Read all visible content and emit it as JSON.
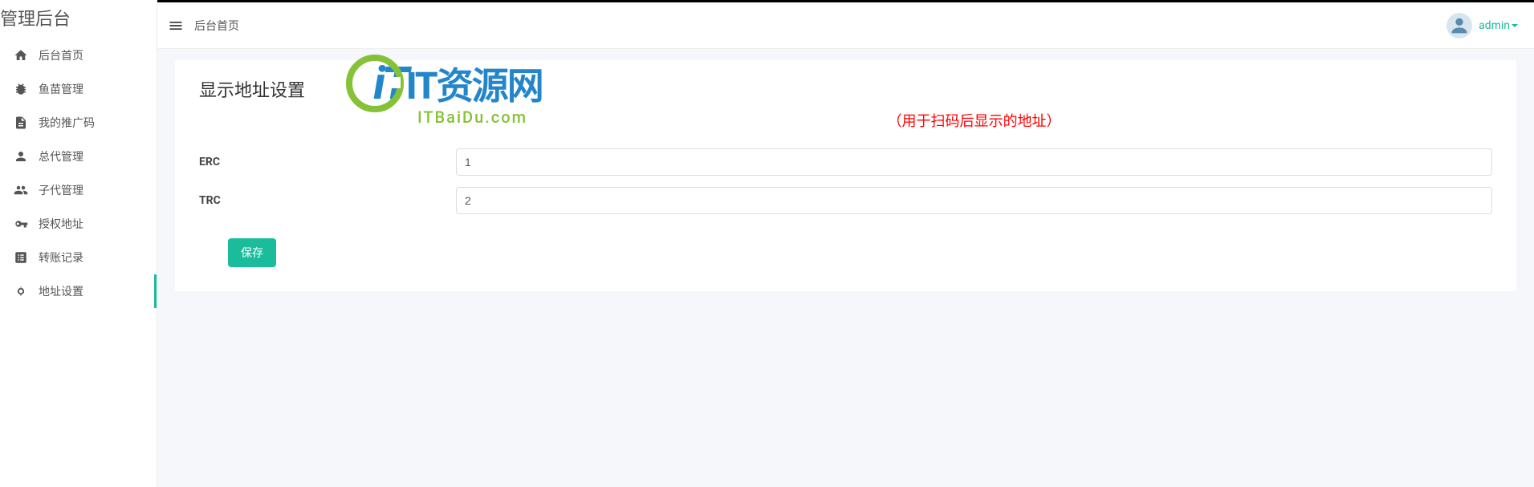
{
  "sidebar": {
    "title": "管理后台",
    "items": [
      {
        "label": "后台首页",
        "icon": "home"
      },
      {
        "label": "鱼苗管理",
        "icon": "bug"
      },
      {
        "label": "我的推广码",
        "icon": "file"
      },
      {
        "label": "总代管理",
        "icon": "person"
      },
      {
        "label": "子代管理",
        "icon": "group"
      },
      {
        "label": "授权地址",
        "icon": "key"
      },
      {
        "label": "转账记录",
        "icon": "list"
      },
      {
        "label": "地址设置",
        "icon": "settings-network"
      }
    ],
    "active_index": 7
  },
  "header": {
    "breadcrumb": "后台首页",
    "user_name": "admin"
  },
  "panel": {
    "title": "显示地址设置",
    "hint": "（用于扫码后显示的地址）",
    "fields": {
      "erc_label": "ERC",
      "erc_value": "1",
      "trc_label": "TRC",
      "trc_value": "2"
    },
    "save_label": "保存"
  },
  "watermark": {
    "main_left": "iT",
    "main_right": "IT资源网",
    "sub": "ITBaiDu.com"
  }
}
